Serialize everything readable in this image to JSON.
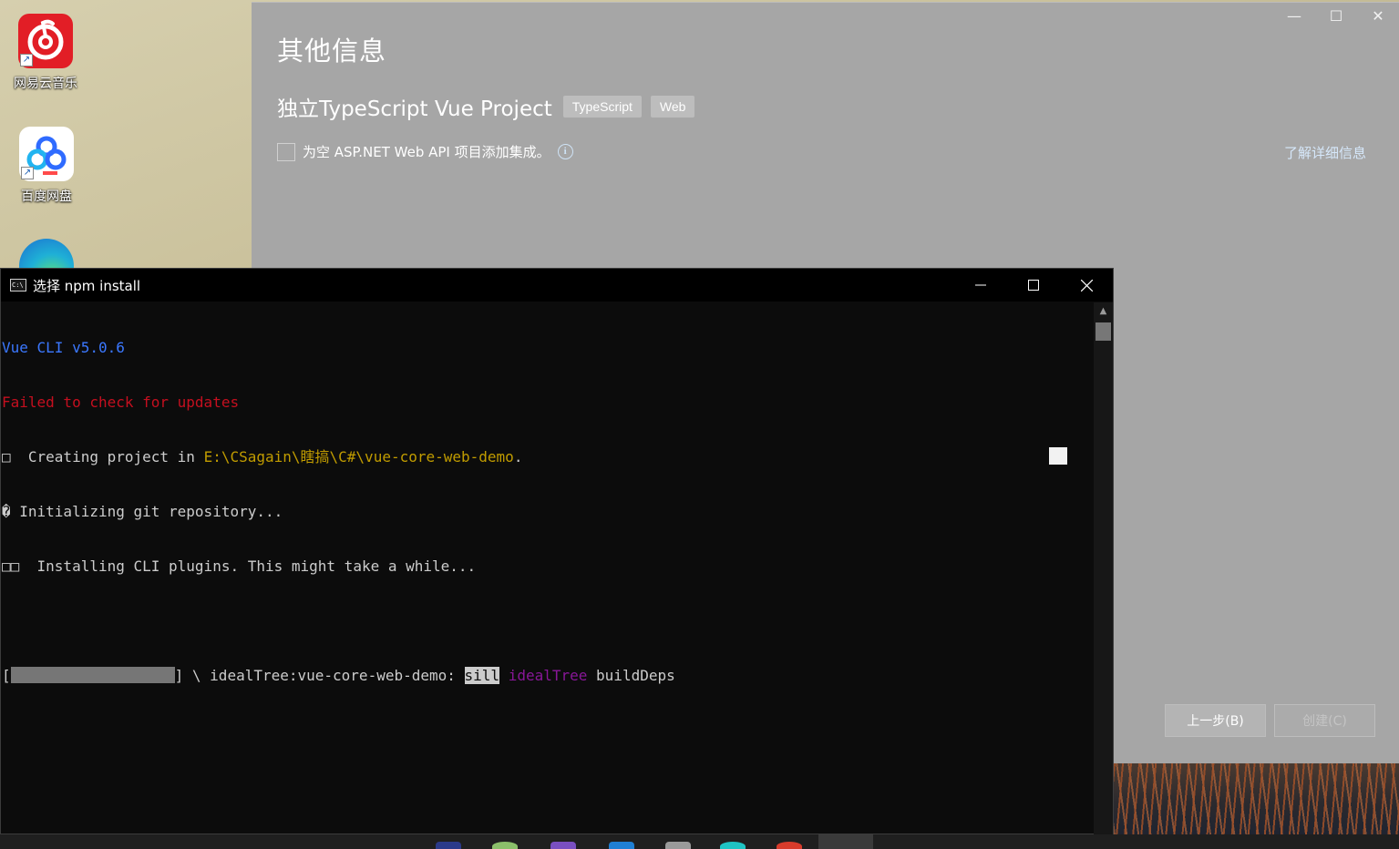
{
  "desktop": {
    "icons": [
      {
        "label": "网易云音乐",
        "icon": "netease-music-icon"
      },
      {
        "label": "百度网盘",
        "icon": "baidu-netdisk-icon"
      },
      {
        "label": "",
        "icon": "edge-browser-icon"
      }
    ]
  },
  "vs_dialog": {
    "title": "其他信息",
    "template_name": "独立TypeScript Vue Project",
    "tags": [
      "TypeScript",
      "Web"
    ],
    "checkbox_label": "为空 ASP.NET Web API 项目添加集成。",
    "checkbox_checked": false,
    "learn_more": "了解详细信息",
    "back_button": "上一步(B)",
    "create_button": "创建(C)",
    "window_controls": {
      "minimize": "—",
      "maximize": "☐",
      "close": "✕"
    }
  },
  "console": {
    "title": "选择 npm install",
    "controls": {
      "minimize": "—",
      "maximize": "☐",
      "close": "✕"
    },
    "lines": {
      "vue_cli": "Vue CLI v5.0.6",
      "failed_check": "Failed to check for updates",
      "creating_prefix": "□  Creating project in ",
      "creating_path": "E:\\CSagain\\瞎搞\\C#\\vue-core-web-demo",
      "creating_suffix": ".",
      "init_git": "� Initializing git repository...",
      "installing": "□□  Installing CLI plugins. This might take a while...",
      "progress_open": "[",
      "progress_close": "] \\ idealTree:vue-core-web-demo: ",
      "sill": "sill",
      "idealtree": "idealTree",
      "builddeps": " buildDeps"
    }
  },
  "colors": {
    "console_bg": "#0c0c0c",
    "console_text": "#cccccc",
    "console_blue": "#3b78ff",
    "console_red": "#c50f1f",
    "console_yellow": "#c19c00",
    "console_magenta": "#881798",
    "dialog_overlay": "#a6a6a6"
  }
}
